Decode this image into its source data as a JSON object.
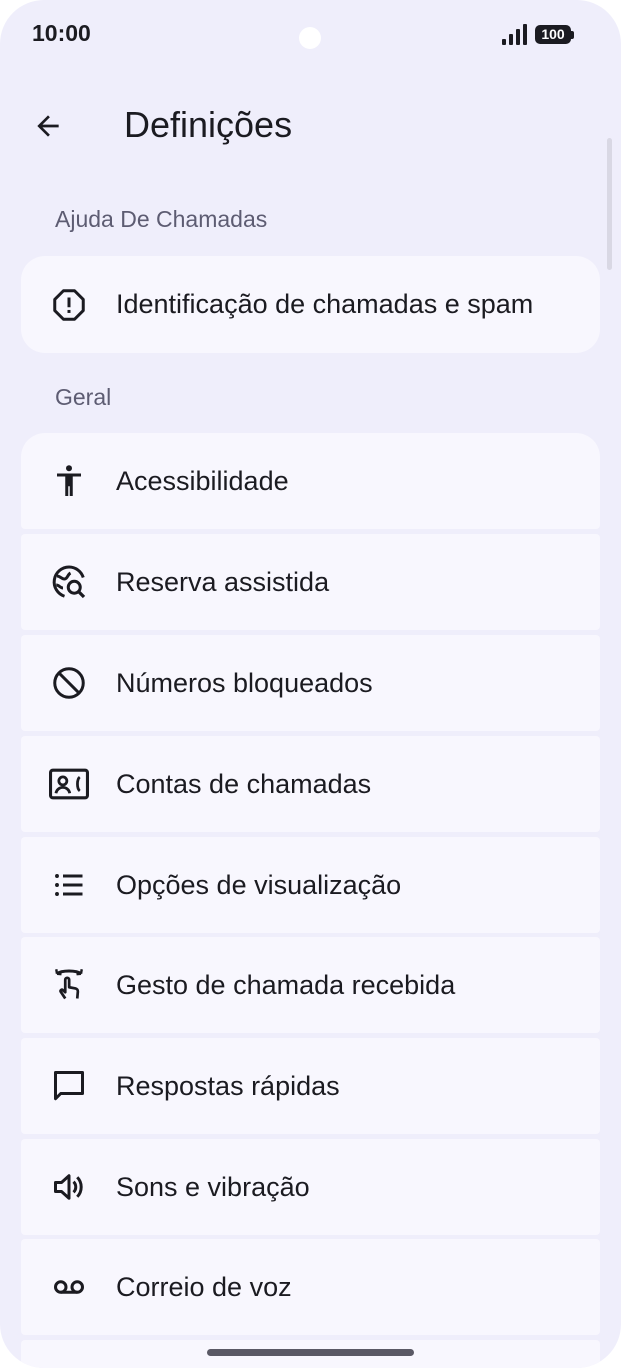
{
  "status_bar": {
    "time": "10:00",
    "battery": "100"
  },
  "header": {
    "title": "Definições"
  },
  "sections": [
    {
      "header": "Ajuda De Chamadas",
      "items": [
        {
          "label": "Identificação de chamadas e spam",
          "icon": "spam-alert-icon"
        }
      ]
    },
    {
      "header": "Geral",
      "items": [
        {
          "label": "Acessibilidade",
          "icon": "accessibility-icon"
        },
        {
          "label": "Reserva assistida",
          "icon": "assisted-dialing-icon"
        },
        {
          "label": "Números bloqueados",
          "icon": "block-icon"
        },
        {
          "label": "Contas de chamadas",
          "icon": "calling-accounts-icon"
        },
        {
          "label": "Opções de visualização",
          "icon": "list-icon"
        },
        {
          "label": "Gesto de chamada recebida",
          "icon": "swipe-gesture-icon"
        },
        {
          "label": "Respostas rápidas",
          "icon": "message-icon"
        },
        {
          "label": "Sons e vibração",
          "icon": "volume-icon"
        },
        {
          "label": "Correio de voz",
          "icon": "voicemail-icon"
        }
      ]
    }
  ],
  "colors": {
    "background": "#efeefb",
    "card": "#f8f7fe",
    "text": "#1b1b21",
    "section_header": "#5d5c72"
  }
}
